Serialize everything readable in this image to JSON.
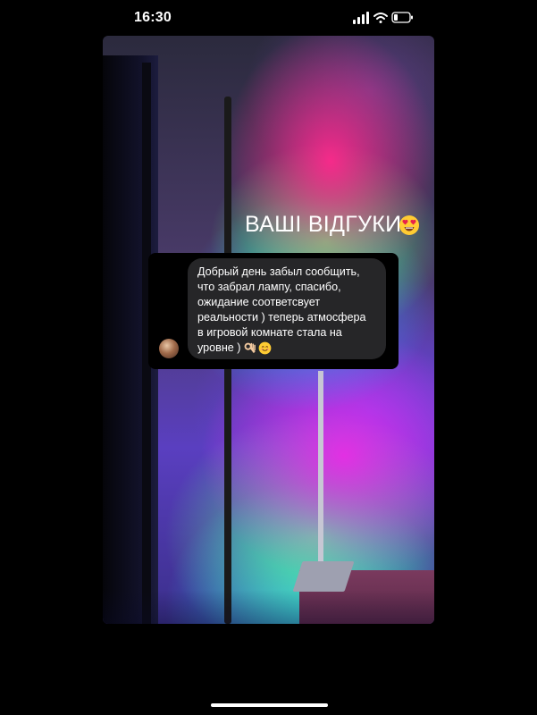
{
  "status_bar": {
    "time": "16:30",
    "icons": [
      "cellular-signal-icon",
      "wifi-icon",
      "battery-icon"
    ]
  },
  "story": {
    "headline": "ВАШІ ВІДГУКИ",
    "headline_emoji": "heart-eyes-icon",
    "review": {
      "message_lines": [
        "Добрый день забыл сообщить,",
        "что забрал лампу, спасибо,",
        "ожидание соответсвует",
        "реальности ) теперь атмосфера",
        "в игровой комнате стала на",
        "уровне )"
      ],
      "trailing_emojis": [
        "ok-hand-icon",
        "smiling-face-icon"
      ]
    }
  },
  "colors": {
    "background": "#000000",
    "bubble": "#262628",
    "text": "#ffffff"
  }
}
